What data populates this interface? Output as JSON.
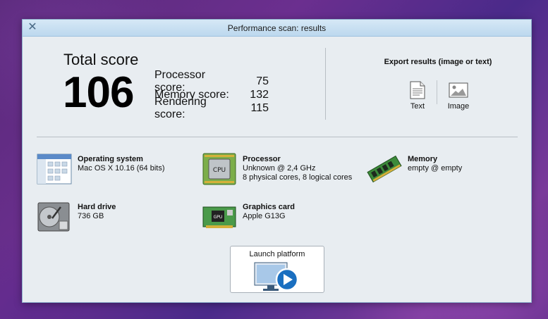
{
  "window": {
    "title": "Performance scan: results"
  },
  "total": {
    "label": "Total score",
    "value": "106"
  },
  "scores": [
    {
      "label": "Processor score:",
      "value": "75"
    },
    {
      "label": "Memory score:",
      "value": "132"
    },
    {
      "label": "Rendering score:",
      "value": "115"
    }
  ],
  "export": {
    "title": "Export results (image or text)",
    "text_label": "Text",
    "image_label": "Image"
  },
  "hardware": {
    "os": {
      "title": "Operating system",
      "lines": [
        "Mac OS X 10.16 (64 bits)"
      ],
      "icon": "window-icon"
    },
    "cpu": {
      "title": "Processor",
      "lines": [
        "Unknown @ 2,4 GHz",
        "8 physical cores, 8 logical cores"
      ],
      "icon": "cpu-icon",
      "chip_text": "CPU"
    },
    "memory": {
      "title": "Memory",
      "lines": [
        "empty @ empty"
      ],
      "icon": "ram-icon"
    },
    "drive": {
      "title": "Hard drive",
      "lines": [
        "736 GB"
      ],
      "icon": "hard-drive-icon"
    },
    "gpu": {
      "title": "Graphics card",
      "lines": [
        "Apple G13G"
      ],
      "icon": "graphics-card-icon",
      "chip_text": "GPU"
    }
  },
  "launch": {
    "label": "Launch platform"
  },
  "colors": {
    "accent": "#1a6fc0",
    "titlebar": "#c8e0f2",
    "window_bg": "#e8edf1"
  }
}
